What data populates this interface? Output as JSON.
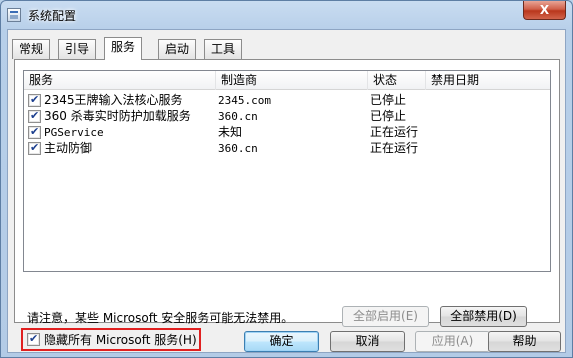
{
  "window": {
    "title": "系统配置",
    "close_glyph": "X"
  },
  "tabs": [
    {
      "label": "常规",
      "active": false
    },
    {
      "label": "引导",
      "active": false
    },
    {
      "label": "服务",
      "active": true
    },
    {
      "label": "启动",
      "active": false
    },
    {
      "label": "工具",
      "active": false
    }
  ],
  "services": {
    "columns": [
      "服务",
      "制造商",
      "状态",
      "禁用日期"
    ],
    "rows": [
      {
        "checked": true,
        "name": "2345王牌输入法核心服务",
        "vendor": "2345.com",
        "status": "已停止",
        "disabled_date": ""
      },
      {
        "checked": true,
        "name": "360 杀毒实时防护加载服务",
        "vendor": "360.cn",
        "status": "已停止",
        "disabled_date": ""
      },
      {
        "checked": true,
        "name": "PGService",
        "vendor": "未知",
        "status": "正在运行",
        "disabled_date": ""
      },
      {
        "checked": true,
        "name": "主动防御",
        "vendor": "360.cn",
        "status": "正在运行",
        "disabled_date": ""
      }
    ],
    "note": "请注意，某些 Microsoft 安全服务可能无法禁用。",
    "enable_all_label": "全部启用(E)",
    "disable_all_label": "全部禁用(D)",
    "hide_ms_label": "隐藏所有 Microsoft 服务(H)",
    "hide_ms_checked": true
  },
  "footer": {
    "ok_label": "确定",
    "cancel_label": "取消",
    "apply_label": "应用(A)",
    "help_label": "帮助"
  }
}
